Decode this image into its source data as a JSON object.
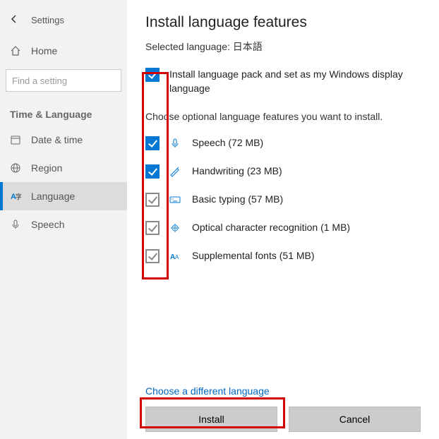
{
  "sidebar": {
    "back_label": "Settings",
    "home_label": "Home",
    "search_placeholder": "Find a setting",
    "category": "Time & Language",
    "items": [
      {
        "label": "Date & time",
        "icon": "calendar-clock-icon"
      },
      {
        "label": "Region",
        "icon": "globe-icon"
      },
      {
        "label": "Language",
        "icon": "language-a-icon",
        "active": true
      },
      {
        "label": "Speech",
        "icon": "microphone-icon"
      }
    ]
  },
  "main": {
    "title": "Install language features",
    "subtitle_prefix": "Selected language: ",
    "selected_language": "日本語",
    "primary_feature": "Install language pack and set as my Windows display language",
    "instructions": "Choose optional language features you want to install.",
    "features": [
      {
        "label": "Speech (72 MB)",
        "icon": "microphone-icon",
        "checked": true,
        "locked": false
      },
      {
        "label": "Handwriting (23 MB)",
        "icon": "handwriting-icon",
        "checked": true,
        "locked": false
      },
      {
        "label": "Basic typing (57 MB)",
        "icon": "keyboard-icon",
        "checked": false,
        "locked": true
      },
      {
        "label": "Optical character recognition (1 MB)",
        "icon": "ocr-icon",
        "checked": false,
        "locked": true
      },
      {
        "label": "Supplemental fonts (51 MB)",
        "icon": "fonts-icon",
        "checked": false,
        "locked": true
      }
    ],
    "link": "Choose a different language",
    "install_button": "Install",
    "cancel_button": "Cancel"
  },
  "colors": {
    "accent": "#0078d4",
    "annotation": "#d30000"
  }
}
